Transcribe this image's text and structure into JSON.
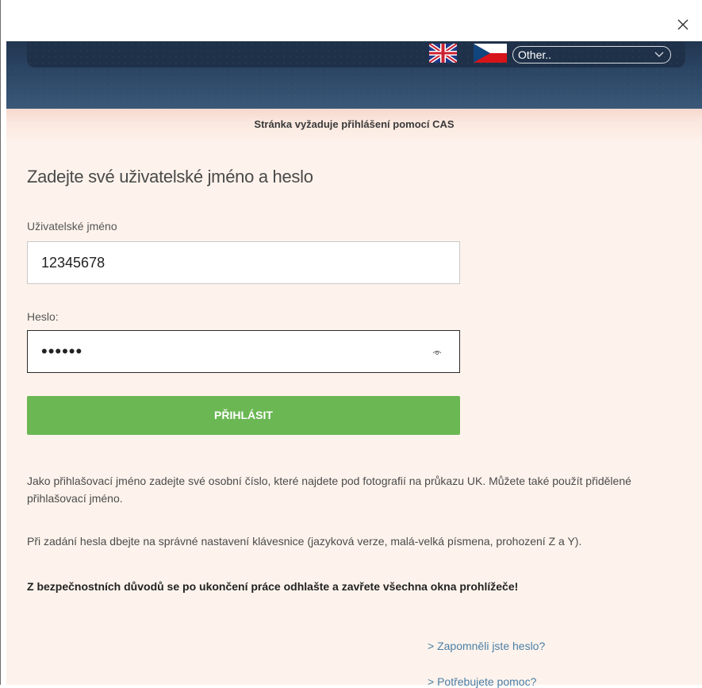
{
  "header": {
    "language_options": {
      "selected": "Other.."
    }
  },
  "notice": {
    "text": "Stránka vyžaduje přihlášení pomocí CAS"
  },
  "form": {
    "heading": "Zadejte své uživatelské jméno a heslo",
    "username_label": "Uživatelské jméno",
    "username_value": "12345678",
    "password_label": "Heslo:",
    "password_value": "••••••",
    "submit_label": "PŘIHLÁSIT"
  },
  "info": {
    "paragraph1": "Jako přihlašovací jméno zadejte své osobní číslo, které najdete pod fotografií na průkazu UK. Můžete také použít přidělené přihlašovací jméno.",
    "paragraph2": "Při zadání hesla dbejte na správné nastavení klávesnice (jazyková verze, malá-velká písmena, prohození Z a Y).",
    "warning": "Z bezpečnostních důvodů se po ukončení práce odhlašte a zavřete všechna okna prohlížeče!"
  },
  "links": {
    "forgot_password": "> Zapomněli jste heslo?",
    "need_help": "> Potřebujete pomoc?"
  },
  "colors": {
    "header": "#223650",
    "notice": "#f6d8cd",
    "panel": "#fdf3ec",
    "button": "#6ab754",
    "link": "#4a7fa6"
  }
}
